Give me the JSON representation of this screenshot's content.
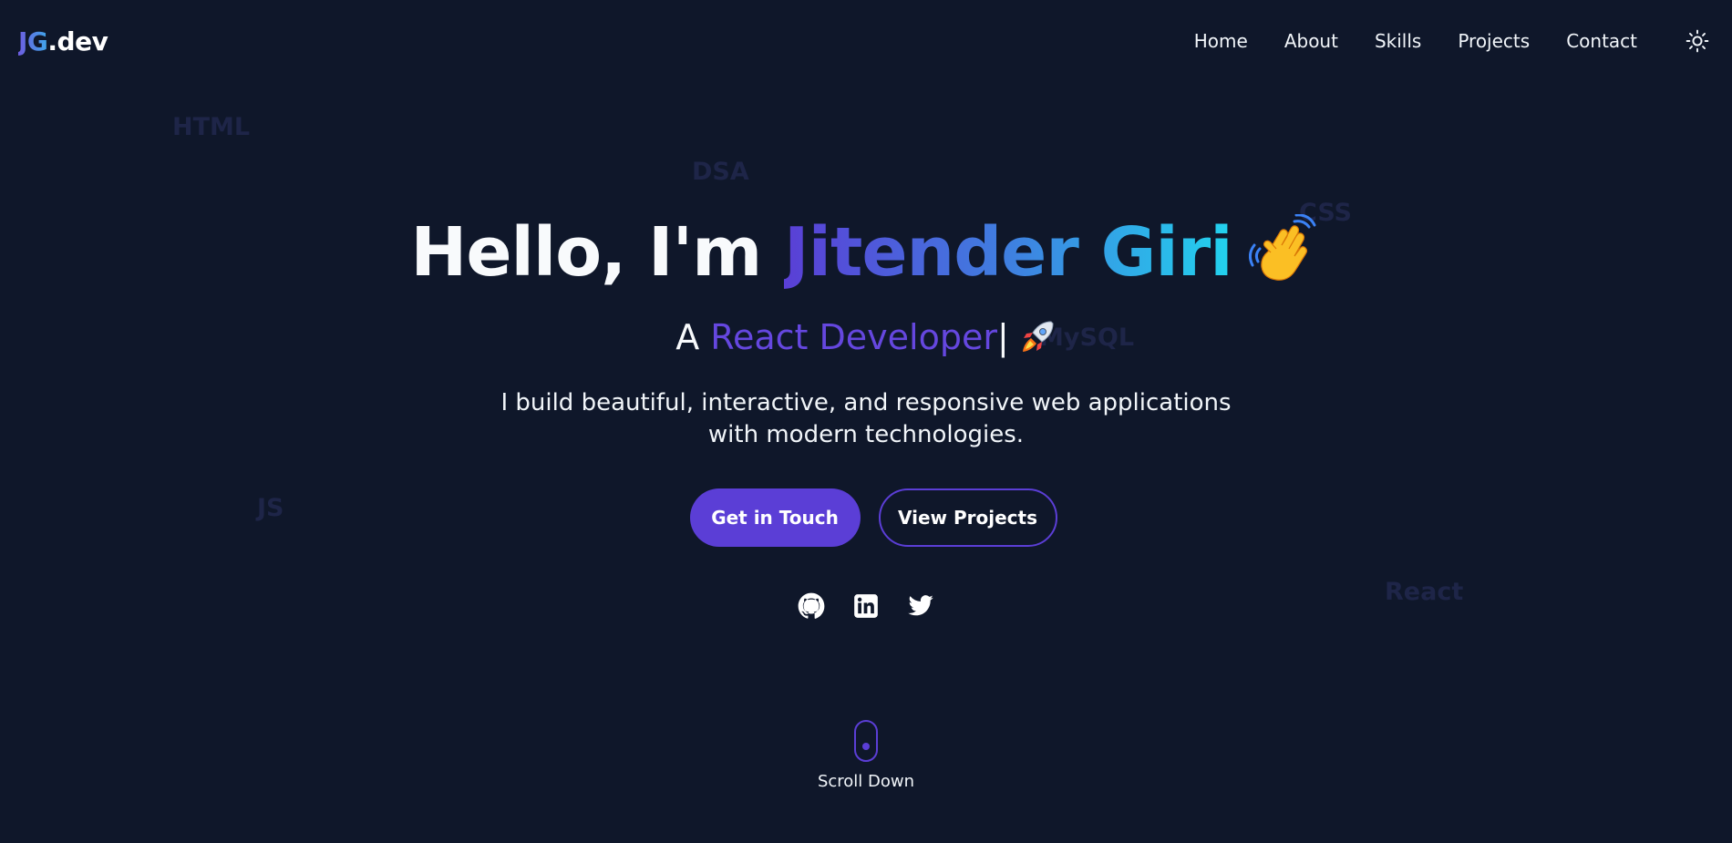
{
  "nav": {
    "logo_initials": "JG",
    "logo_suffix": ".dev",
    "links": [
      {
        "label": "Home"
      },
      {
        "label": "About"
      },
      {
        "label": "Skills"
      },
      {
        "label": "Projects"
      },
      {
        "label": "Contact"
      }
    ],
    "theme_toggle_icon": "sun-icon"
  },
  "background_words": [
    "HTML",
    "DSA",
    "CSS",
    "MySQL",
    "JS",
    "React"
  ],
  "hero": {
    "greeting": "Hello, I'm ",
    "name": "Jitender Giri",
    "wave_icon": "waving-hand-icon",
    "subtitle_prefix": "A ",
    "subtitle_role": "React Developer",
    "cursor": "|",
    "rocket_icon": "rocket-icon",
    "description": "I build beautiful, interactive, and responsive web applications with modern technologies.",
    "primary_button": "Get in Touch",
    "secondary_button": "View Projects"
  },
  "socials": [
    {
      "icon": "github-icon"
    },
    {
      "icon": "linkedin-icon"
    },
    {
      "icon": "twitter-icon"
    }
  ],
  "scroll": {
    "label": "Scroll Down"
  },
  "colors": {
    "background": "#0f172a",
    "accent": "#5b3ed6",
    "gradient_end": "#22d3ee",
    "faded_word": "#1e2548"
  }
}
